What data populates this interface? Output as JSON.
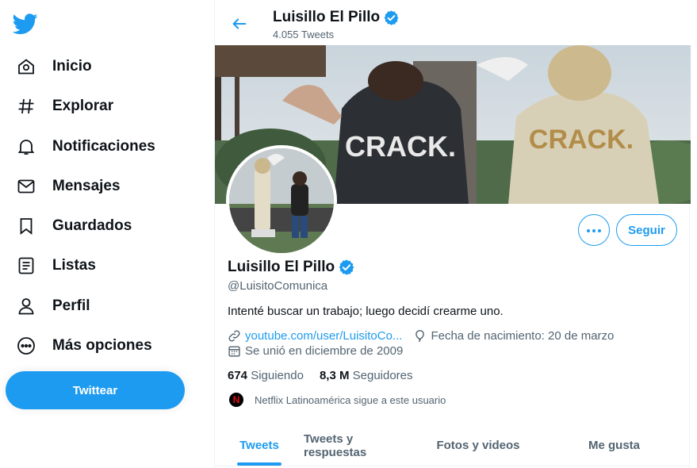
{
  "colors": {
    "accent": "#1d9bf0",
    "text": "#0f1419",
    "muted": "#536471"
  },
  "sidebar": {
    "logo_icon": "twitter-bird-icon",
    "items": [
      {
        "label": "Inicio",
        "icon": "home-icon"
      },
      {
        "label": "Explorar",
        "icon": "hashtag-icon"
      },
      {
        "label": "Notificaciones",
        "icon": "bell-icon"
      },
      {
        "label": "Mensajes",
        "icon": "envelope-icon"
      },
      {
        "label": "Guardados",
        "icon": "bookmark-icon"
      },
      {
        "label": "Listas",
        "icon": "list-icon"
      },
      {
        "label": "Perfil",
        "icon": "person-icon"
      },
      {
        "label": "Más opciones",
        "icon": "more-circle-icon"
      }
    ],
    "tweet_button": "Twittear"
  },
  "header": {
    "name": "Luisillo El Pillo",
    "tweet_count": "4.055 Tweets"
  },
  "banner": {
    "text_left": "CRACK.",
    "text_right": "CRACK."
  },
  "profile": {
    "name": "Luisillo El Pillo",
    "handle": "@LuisitoComunica",
    "bio": "Intenté buscar un trabajo; luego decidí crearme uno.",
    "website": "youtube.com/user/LuisitoCo...",
    "birthday": "Fecha de nacimiento: 20 de marzo",
    "joined": "Se unió en diciembre de 2009",
    "following_count": "674",
    "following_label": "Siguiendo",
    "followers_count": "8,3 M",
    "followers_label": "Seguidores",
    "followed_by": "Netflix Latinoamérica sigue a este usuario",
    "follow_button": "Seguir"
  },
  "tabs": [
    {
      "label": "Tweets",
      "active": true
    },
    {
      "label": "Tweets y respuestas",
      "active": false
    },
    {
      "label": "Fotos y videos",
      "active": false
    },
    {
      "label": "Me gusta",
      "active": false
    }
  ]
}
